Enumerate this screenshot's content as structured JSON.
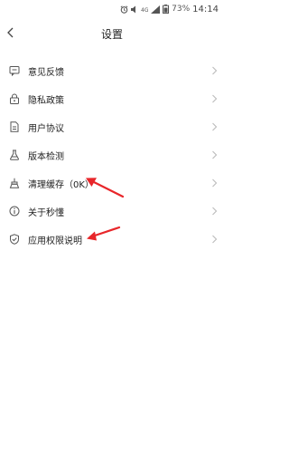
{
  "status_bar": {
    "battery_percent": "73%",
    "time": "14:14",
    "icons": [
      "alarm-icon",
      "volume-icon",
      "network-4g-icon",
      "signal-icon",
      "battery-icon"
    ]
  },
  "header": {
    "title": "设置",
    "back_icon": "back-arrow-icon"
  },
  "menu": {
    "items": [
      {
        "id": "feedback",
        "label": "意见反馈",
        "icon": "feedback-icon"
      },
      {
        "id": "privacy",
        "label": "隐私政策",
        "icon": "lock-icon"
      },
      {
        "id": "agreement",
        "label": "用户协议",
        "icon": "document-icon"
      },
      {
        "id": "version",
        "label": "版本检测",
        "icon": "flask-icon"
      },
      {
        "id": "clear-cache",
        "label": "清理缓存（0K）",
        "icon": "broom-icon"
      },
      {
        "id": "about",
        "label": "关于秒懂",
        "icon": "info-icon"
      },
      {
        "id": "permissions",
        "label": "应用权限说明",
        "icon": "shield-icon"
      }
    ],
    "chevron_icon": "chevron-right-icon"
  },
  "annotations": {
    "arrow_color": "#e8262a"
  }
}
